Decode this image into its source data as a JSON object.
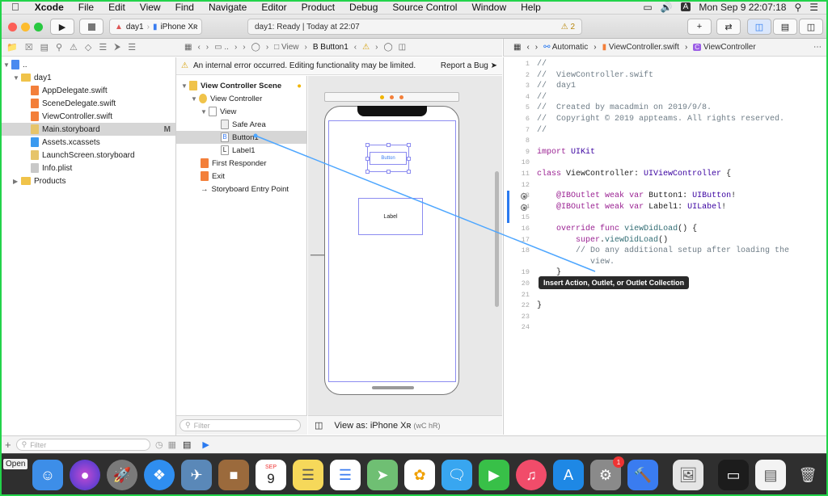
{
  "menubar": {
    "apple": "",
    "app": "Xcode",
    "items": [
      "File",
      "Edit",
      "View",
      "Find",
      "Navigate",
      "Editor",
      "Product",
      "Debug",
      "Source Control",
      "Window",
      "Help"
    ],
    "user_badge": "A",
    "clock": "Mon Sep 9  22:07:18"
  },
  "toolbar": {
    "scheme": "day1",
    "device": "iPhone Xʀ",
    "status": "day1: Ready | Today at 22:07",
    "warning_count": "2"
  },
  "navigator": {
    "items": [
      {
        "label": "..",
        "level": 0
      },
      {
        "label": "day1",
        "level": 1
      },
      {
        "label": "AppDelegate.swift",
        "level": 2
      },
      {
        "label": "SceneDelegate.swift",
        "level": 2
      },
      {
        "label": "ViewController.swift",
        "level": 2
      },
      {
        "label": "Main.storyboard",
        "level": 2,
        "badge": "M",
        "selected": true
      },
      {
        "label": "Assets.xcassets",
        "level": 2
      },
      {
        "label": "LaunchScreen.storyboard",
        "level": 2
      },
      {
        "label": "Info.plist",
        "level": 2
      },
      {
        "label": "Products",
        "level": 1
      }
    ],
    "filter_placeholder": "Filter"
  },
  "ib_jump": {
    "view": "View",
    "button": "Button1"
  },
  "error_bar": {
    "message": "An internal error occurred. Editing functionality may be limited.",
    "report": "Report a Bug"
  },
  "outline": {
    "items": [
      {
        "label": "View Controller Scene",
        "level": 0
      },
      {
        "label": "View Controller",
        "level": 1
      },
      {
        "label": "View",
        "level": 2
      },
      {
        "label": "Safe Area",
        "level": 3
      },
      {
        "label": "Button1",
        "level": 3,
        "selected": true
      },
      {
        "label": "Label1",
        "level": 3
      },
      {
        "label": "First Responder",
        "level": 1
      },
      {
        "label": "Exit",
        "level": 1
      },
      {
        "label": "Storyboard Entry Point",
        "level": 1
      }
    ],
    "filter_placeholder": "Filter"
  },
  "canvas": {
    "button_text": "Button",
    "label_text": "Label"
  },
  "view_as": {
    "label": "View as: iPhone Xʀ",
    "shortcut": "(wC hR)"
  },
  "code_jump": {
    "mode": "Automatic",
    "file": "ViewController.swift",
    "symbol": "ViewController"
  },
  "code": {
    "lines": [
      "//",
      "//  ViewController.swift",
      "//  day1",
      "//",
      "//  Created by macadmin on 2019/9/8.",
      "//  Copyright © 2019 appteams. All rights reserved.",
      "//",
      "",
      "import UIKit",
      "",
      "class ViewController: UIViewController {",
      "",
      "    @IBOutlet weak var Button1: UIButton!",
      "    @IBOutlet weak var Label1: UILabel!",
      "",
      "    override func viewDidLoad() {",
      "        super.viewDidLoad()",
      "        // Do any additional setup after loading the",
      "           view.",
      "    }",
      "",
      "",
      "}",
      "",
      ""
    ],
    "numbers": [
      "1",
      "2",
      "3",
      "4",
      "5",
      "6",
      "7",
      "8",
      "9",
      "10",
      "11",
      "12",
      "13",
      "14",
      "15",
      "16",
      "17",
      "18",
      "",
      "19",
      "20",
      "21",
      "22",
      "23",
      "24"
    ]
  },
  "tooltip": "Insert Action, Outlet, or Outlet Collection",
  "dock": {
    "open_label": "Open",
    "calendar_month": "SEP",
    "calendar_day": "9",
    "badge_count": "1"
  }
}
